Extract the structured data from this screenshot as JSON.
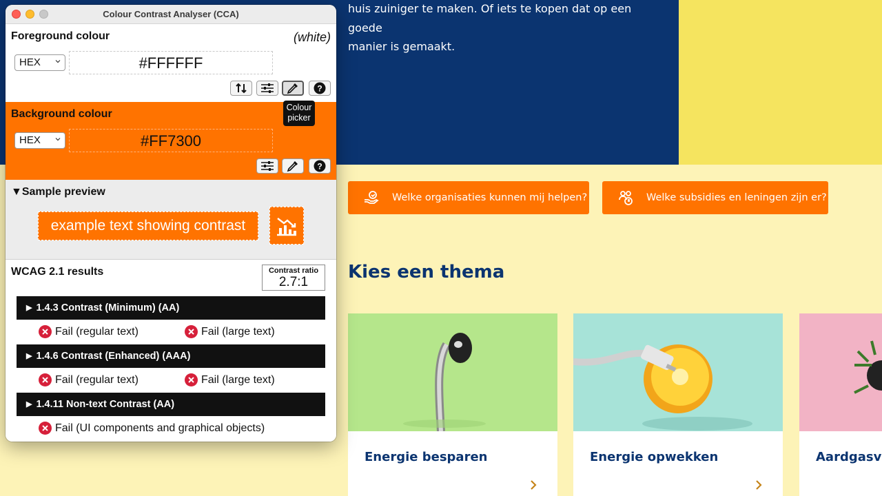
{
  "website": {
    "hero_line1": "huis zuiniger te maken. Of iets te kopen dat op een goede",
    "hero_line2": "manier is gemaakt.",
    "cta_buttons": [
      {
        "label": "Welke organisaties kunnen mij helpen?",
        "icon": "helping-hand-icon"
      },
      {
        "label": "Welke subsidies en leningen zijn er?",
        "icon": "people-euro-icon"
      }
    ],
    "section_title": "Kies een thema",
    "cards": [
      {
        "title": "Energie besparen",
        "image": "shower-head-image"
      },
      {
        "title": "Energie opwekken",
        "image": "lemon-plug-image"
      },
      {
        "title": "Aardgasvrij",
        "image": "plant-image"
      }
    ],
    "colors": {
      "navy": "#0b3470",
      "orange": "#ff7300",
      "cream": "#fdf3b7",
      "yellow": "#f5e45f"
    }
  },
  "cca": {
    "window_title": "Colour Contrast Analyser (CCA)",
    "foreground": {
      "heading": "Foreground colour",
      "colour_name": "(white)",
      "format": "HEX",
      "value": "#FFFFFF",
      "tools": [
        "swap-icon",
        "sliders-icon",
        "eyedropper-icon",
        "help-icon"
      ]
    },
    "tooltip": "Colour picker",
    "background": {
      "heading": "Background colour",
      "format": "HEX",
      "value": "#FF7300",
      "tools": [
        "sliders-icon",
        "eyedropper-icon",
        "help-icon"
      ]
    },
    "preview": {
      "heading": "Sample preview",
      "sample_text": "example text showing contrast",
      "sample_icon": "chart-decrease-icon"
    },
    "results": {
      "heading": "WCAG 2.1 results",
      "ratio_label": "Contrast ratio",
      "ratio_value": "2.7:1",
      "criteria": [
        {
          "label": "1.4.3 Contrast (Minimum) (AA)",
          "results": [
            "Fail (regular text)",
            "Fail (large text)"
          ]
        },
        {
          "label": "1.4.6 Contrast (Enhanced) (AAA)",
          "results": [
            "Fail (regular text)",
            "Fail (large text)"
          ]
        },
        {
          "label": "1.4.11 Non-text Contrast (AA)",
          "results": [
            "Fail (UI components and graphical objects)"
          ]
        }
      ]
    }
  }
}
